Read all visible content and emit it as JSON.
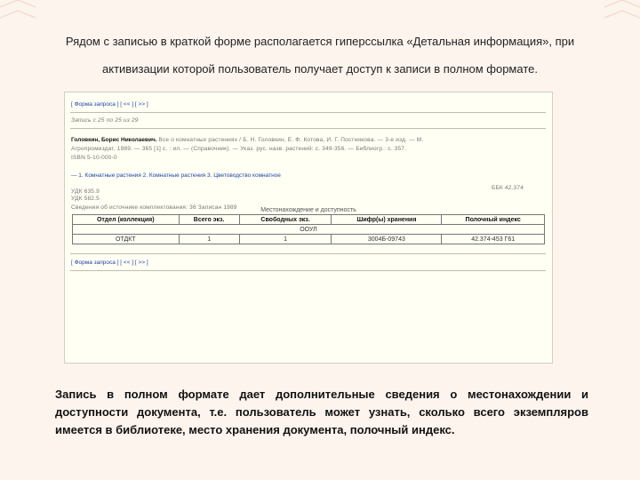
{
  "slide": {
    "title_line1": "Рядом с записью в краткой форме располагается гиперссылка «Детальная информация», при",
    "title_line2": "активизации которой пользователь получает доступ к записи в полном формате.",
    "body_line1": "Запись в полном формате дает дополнительные сведения о местонахождении и",
    "body_line2": "доступности документа, т.е. пользователь может узнать, сколько всего экземпляров",
    "body_line3": "имеется в библиотеке, место хранения документа, полочный индекс."
  },
  "screenshot": {
    "nav_top": "[ Форма запроса ] [ << ] [ >> ]",
    "record_label": "Запись с 25 по 25 из 29",
    "author_bold": "Головкин, Борис Николаевич.",
    "author_rest": "Все о комнатных растениях / Б. Н. Головкин, Е. Ф. Котова, И. Г. Постникова. — 3-е изд. — М.",
    "pub_line": "Агропромиздат, 1989. — 365 [1] с. : ил. — (Справочник). — Указ. рус. назв. растений: с. 349-356. — Библиогр.: с. 357.",
    "isbn_line": "ISBN 5-10-000-0",
    "subjects_line": "— 1. Комнатные растения 2. Комнатные растения 3. Цветоводство комнатное",
    "udc1": "УДК 635.9",
    "udc2": "УДК 582.5",
    "bbk": "ББК 42.374",
    "source_line": "Сведения об источнике комплектования: 36 Записан 1989",
    "holdings_caption": "Местонахождение и доступность",
    "headers": [
      "Отдел (коллекция)",
      "Всего экз.",
      "Свободных экз.",
      "Шифр(ы) хранения",
      "Полочный индекс"
    ],
    "dept_row": "ООУЛ",
    "data_row": [
      "ОТДКТ",
      "1",
      "1",
      "3004Б-09743",
      "42.374-453 Г61"
    ],
    "nav_bottom": "[ Форма запроса ] [ << ] [ >> ]"
  },
  "colors": {
    "slide_bg": "#fdf4ee",
    "shot_bg": "#fffff4",
    "link": "#2244aa",
    "corner_accent": "#e9c9b4"
  }
}
